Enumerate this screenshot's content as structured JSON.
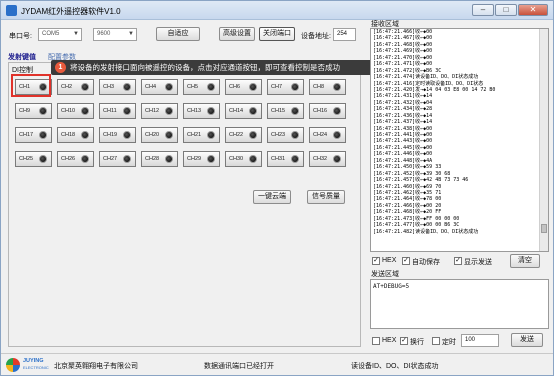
{
  "window": {
    "title": "JYDAM红外遥控器软件V1.0",
    "minimize": "–",
    "maximize": "□",
    "close": "✕"
  },
  "toolbar": {
    "port_label": "串口号:",
    "port_value": "COM5",
    "baud_value": "9600",
    "auto_adapt": "自适应",
    "advanced": "高级设置",
    "close_port": "关闭端口",
    "address_label": "设备地址:",
    "address_value": "254"
  },
  "tabs": [
    "发射键值",
    "配置参数"
  ],
  "section_label": "DI控制",
  "channels": [
    "CH1",
    "CH2",
    "CH3",
    "CH4",
    "CH5",
    "CH6",
    "CH7",
    "CH8",
    "CH9",
    "CH10",
    "CH11",
    "CH12",
    "CH13",
    "CH14",
    "CH15",
    "CH16",
    "CH17",
    "CH18",
    "CH19",
    "CH20",
    "CH21",
    "CH22",
    "CH23",
    "CH24",
    "CH25",
    "CH26",
    "CH27",
    "CH28",
    "CH29",
    "CH30",
    "CH31",
    "CH32"
  ],
  "tooltip": {
    "number": "1",
    "text": "将设备的发射接口面向被遥控的设备，点击对应通道按钮，即可查看控制是否成功"
  },
  "actions": {
    "cloud": "一键云端",
    "signal": "信号质量"
  },
  "receive": {
    "title": "接收区域",
    "lines": [
      "[16:47:21.466]收←◆00",
      "[16:47:21.467]收←◆00",
      "[16:47:21.468]收←◆00",
      "[16:47:21.469]收←◆00",
      "[16:47:21.470]收←◆00",
      "[16:47:21.471]收←◆00",
      "[16:47:21.472]收←◆B6 3C",
      "[16:47:21.474]读设备ID、DO、DI状态成功",
      "[16:47:21.416]定时读取设备ID、DO、DI状态",
      "[16:47:21.420]发→◆14 04 03 E8 00 14 72 B0",
      "[16:47:21.431]收←◆14",
      "[16:47:21.432]收←◆04",
      "[16:47:21.434]收←◆28",
      "[16:47:21.436]收←◆14",
      "[16:47:21.437]收←◆14",
      "[16:47:21.438]收←◆00",
      "[16:47:21.441]收←◆00",
      "[16:47:21.443]收←◆00",
      "[16:47:21.445]收←◆00",
      "[16:47:21.446]收←◆00",
      "[16:47:21.448]收←◆4A",
      "[16:47:21.450]收←◆59 33",
      "[16:47:21.452]收←◆39 30 68",
      "[16:47:21.457]收←◆42 4B 73 73 46",
      "[16:47:21.460]收←◆69 70",
      "[16:47:21.462]收←◆35 71",
      "[16:47:21.464]收←◆78 00",
      "[16:47:21.466]收←◆00 20",
      "[16:47:21.468]收←◆20 FF",
      "[16:47:21.473]收←◆FF 00 00 00",
      "[16:47:21.477]收←◆00 00 B6 3C",
      "[16:47:21.482]读设备ID、DO、DI状态成功"
    ]
  },
  "receive_options": {
    "hex": "HEX",
    "autosave": "自动保存",
    "show_send": "显示发送",
    "clear": "清空"
  },
  "send": {
    "title": "发送区域",
    "content": "AT+DEBUG=5",
    "hex": "HEX",
    "newline": "换行",
    "timer": "定时",
    "interval": "100",
    "send_button": "发送"
  },
  "status": {
    "company": "北京聚英翱翔电子有限公司",
    "conn": "数据通讯端口已经打开",
    "last": "读设备ID、DO、DI状态成功",
    "logo_text": "JUYING",
    "logo_sub": "ELECTRONIC"
  },
  "checks": {
    "checked": "✓"
  }
}
